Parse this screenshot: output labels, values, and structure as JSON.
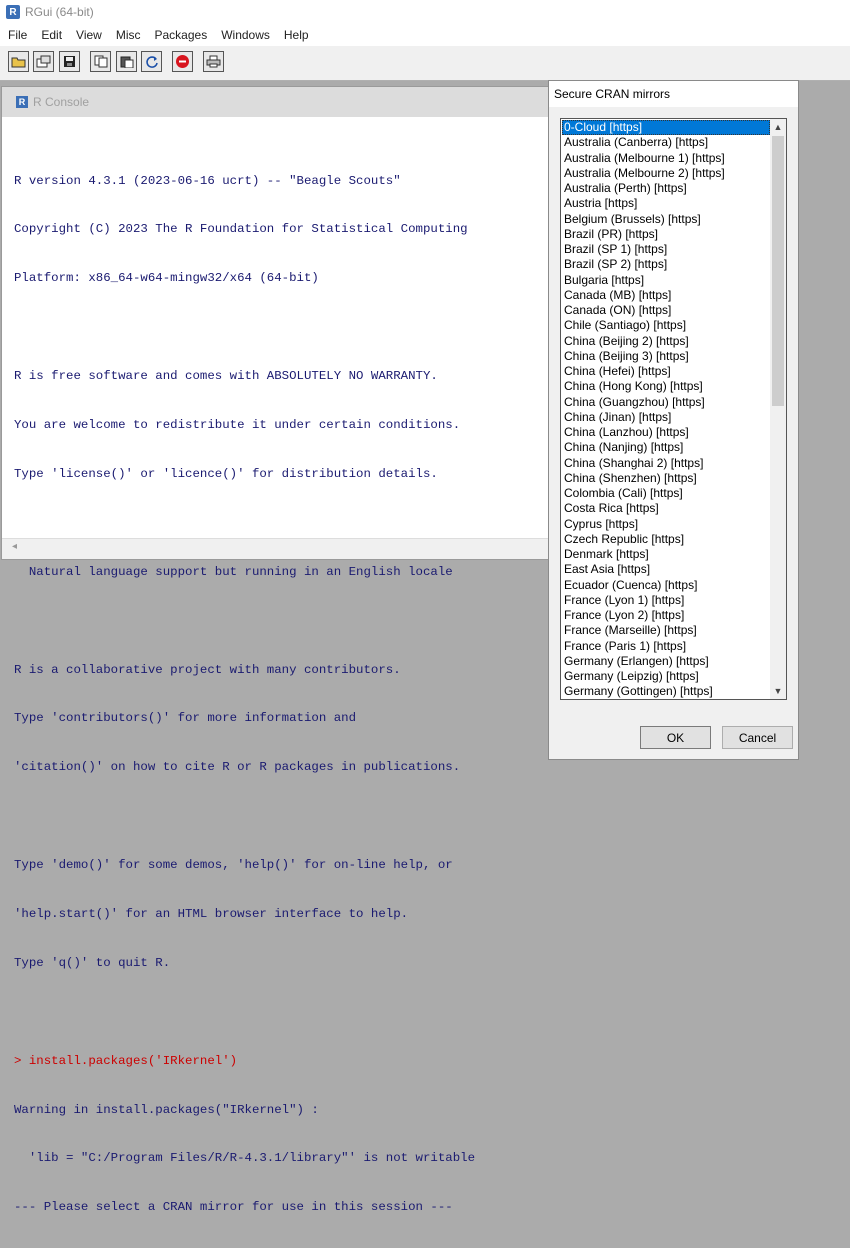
{
  "app": {
    "title": "RGui (64-bit)"
  },
  "menu": [
    "File",
    "Edit",
    "View",
    "Misc",
    "Packages",
    "Windows",
    "Help"
  ],
  "toolbar": {
    "buttons": [
      "open-script-icon",
      "load-workspace-icon",
      "save-workspace-icon",
      "copy-icon",
      "paste-icon",
      "refresh-icon",
      "stop-icon",
      "print-icon"
    ]
  },
  "console": {
    "title": "R Console",
    "lines": [
      "R version 4.3.1 (2023-06-16 ucrt) -- \"Beagle Scouts\"",
      "Copyright (C) 2023 The R Foundation for Statistical Computing",
      "Platform: x86_64-w64-mingw32/x64 (64-bit)",
      "",
      "R is free software and comes with ABSOLUTELY NO WARRANTY.",
      "You are welcome to redistribute it under certain conditions.",
      "Type 'license()' or 'licence()' for distribution details.",
      "",
      "  Natural language support but running in an English locale",
      "",
      "R is a collaborative project with many contributors.",
      "Type 'contributors()' for more information and",
      "'citation()' on how to cite R or R packages in publications.",
      "",
      "Type 'demo()' for some demos, 'help()' for on-line help, or",
      "'help.start()' for an HTML browser interface to help.",
      "Type 'q()' to quit R.",
      ""
    ],
    "prompt": "> ",
    "command": "install.packages('IRkernel')",
    "output": [
      "Warning in install.packages(\"IRkernel\") :",
      "  'lib = \"C:/Program Files/R/R-4.3.1/library\"' is not writable",
      "--- Please select a CRAN mirror for use in this session ---"
    ]
  },
  "dialog": {
    "title": "Secure CRAN mirrors",
    "selected_index": 0,
    "mirrors": [
      "0-Cloud [https]",
      "Australia (Canberra) [https]",
      "Australia (Melbourne 1) [https]",
      "Australia (Melbourne 2) [https]",
      "Australia (Perth) [https]",
      "Austria [https]",
      "Belgium (Brussels) [https]",
      "Brazil (PR) [https]",
      "Brazil (SP 1) [https]",
      "Brazil (SP 2) [https]",
      "Bulgaria [https]",
      "Canada (MB) [https]",
      "Canada (ON) [https]",
      "Chile (Santiago) [https]",
      "China (Beijing 2) [https]",
      "China (Beijing 3) [https]",
      "China (Hefei) [https]",
      "China (Hong Kong) [https]",
      "China (Guangzhou) [https]",
      "China (Jinan) [https]",
      "China (Lanzhou) [https]",
      "China (Nanjing) [https]",
      "China (Shanghai 2) [https]",
      "China (Shenzhen) [https]",
      "Colombia (Cali) [https]",
      "Costa Rica [https]",
      "Cyprus [https]",
      "Czech Republic [https]",
      "Denmark [https]",
      "East Asia [https]",
      "Ecuador (Cuenca) [https]",
      "France (Lyon 1) [https]",
      "France (Lyon 2) [https]",
      "France (Marseille) [https]",
      "France (Paris 1) [https]",
      "Germany (Erlangen) [https]",
      "Germany (Leipzig) [https]",
      "Germany (Gottingen) [https]"
    ],
    "ok_label": "OK",
    "cancel_label": "Cancel"
  }
}
